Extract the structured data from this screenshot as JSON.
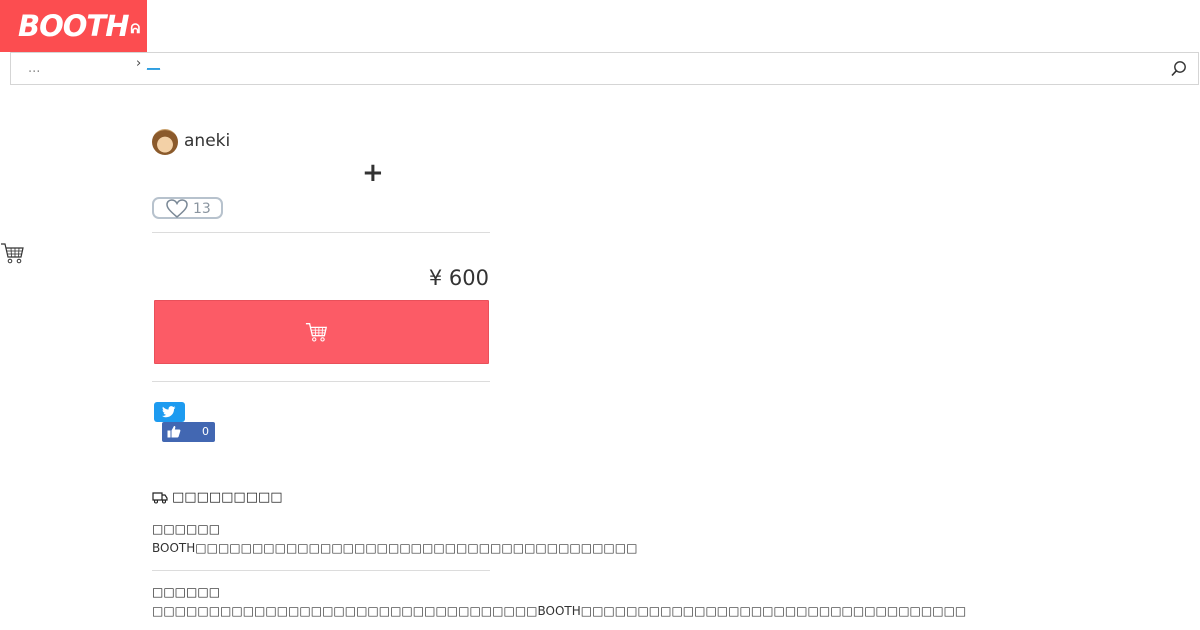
{
  "header": {
    "logo_text": "BOOTH",
    "logo_mark": "ᕱ",
    "brand_color": "#fc4d50"
  },
  "search": {
    "placeholder": "...",
    "breadcrumb_separator": "›",
    "breadcrumb_link": "__",
    "icon": "search-icon"
  },
  "shop": {
    "name": "aneki",
    "follow_label": "+"
  },
  "like": {
    "count": "13",
    "icon": "heart-icon"
  },
  "item": {
    "price": "¥ 600",
    "cart_icon": "cart-icon",
    "cart_button_color": "#fc5b66"
  },
  "share": {
    "twitter_icon": "twitter-icon",
    "fb_like_count": "0",
    "fb_icon": "thumbs-up-icon"
  },
  "shipping": {
    "heading": "□□□□□□□□□",
    "section1_title": "□□□□□□",
    "section1_body": "BOOTH□□□□□□□□□□□□□□□□□□□□□□□□□□□□□□□□□□□□□□□",
    "section2_title": "□□□□□□",
    "section2_body": "□□□□□□□□□□□□□□□□□□□□□□□□□□□□□□□□□□BOOTH□□□□□□□□□□□□□□□□□□□□□□□□□□□□□□□□□□"
  }
}
